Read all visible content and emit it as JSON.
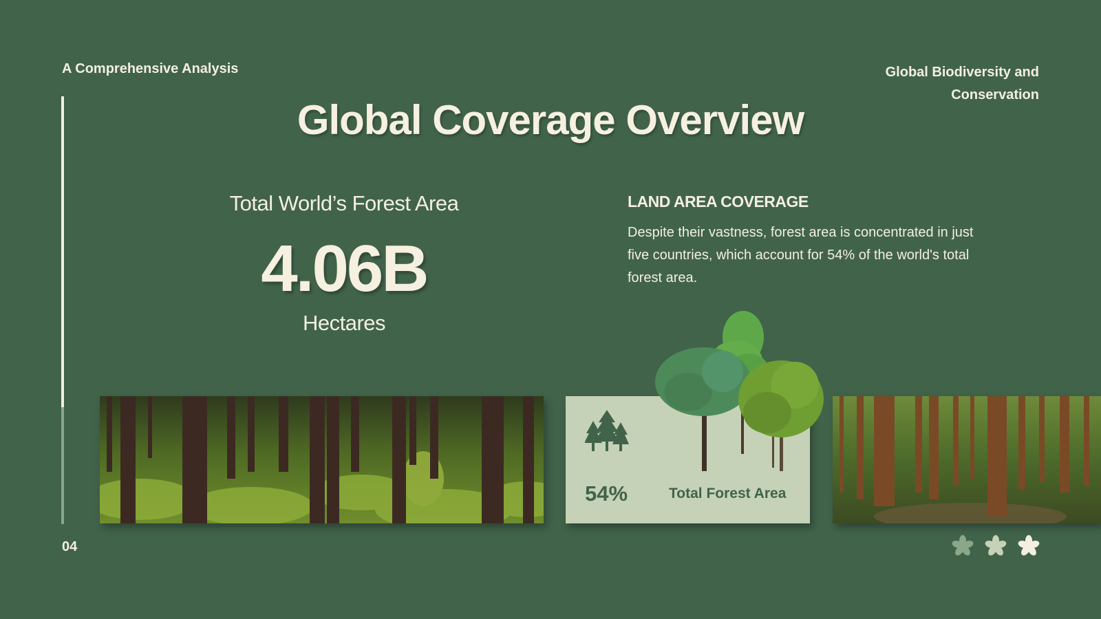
{
  "header": {
    "left_label": "A Comprehensive Analysis",
    "right_label": "Global Biodiversity and Conservation"
  },
  "title": "Global Coverage Overview",
  "stat": {
    "label": "Total World’s Forest Area",
    "value": "4.06B",
    "unit": "Hectares"
  },
  "section": {
    "heading": "LAND AREA COVERAGE",
    "body": "Despite their vastness, forest area is concentrated in just five countries, which account for 54% of the world's total forest area."
  },
  "card": {
    "percent": "54%",
    "label": "Total Forest Area",
    "icon": "trees-icon"
  },
  "images": {
    "left": "moss-forest-photo",
    "center": "three-trees-illustration",
    "right": "sunlit-forest-photo"
  },
  "footer": {
    "page_number": "04",
    "decoration_icons": [
      "flower-icon",
      "flower-icon",
      "flower-icon"
    ]
  },
  "colors": {
    "background": "#41634a",
    "text": "#f3efe1",
    "card_bg": "#c6d2b7",
    "accent_dark": "#41634a"
  }
}
